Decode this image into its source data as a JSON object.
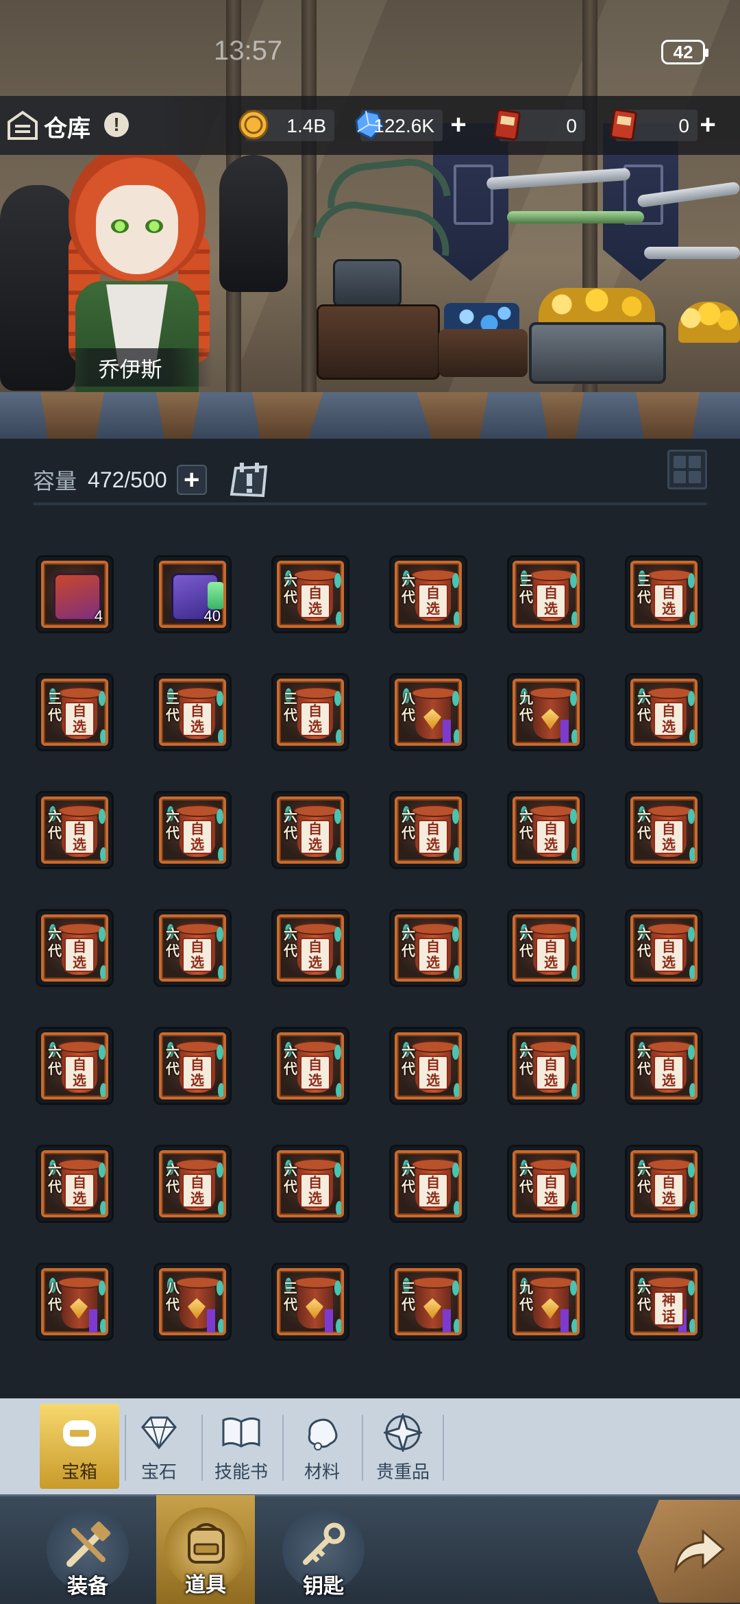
{
  "status_bar": {
    "time": "13:57",
    "battery": "42"
  },
  "header": {
    "title": "仓库",
    "info_icon": "!",
    "resources": [
      {
        "name": "gold",
        "icon": "gold-coin-icon",
        "value": "1.4B"
      },
      {
        "name": "diamond",
        "icon": "diamond-icon",
        "value": "122.6K"
      },
      {
        "name": "generation-ticket",
        "icon": "ticket-red-icon",
        "value": "0"
      },
      {
        "name": "point-ticket",
        "icon": "ticket-point-icon",
        "value": "0"
      }
    ]
  },
  "hero": {
    "name": "乔伊斯"
  },
  "capacity": {
    "label": "容量",
    "value": "472/500"
  },
  "items": [
    {
      "kind": "chest-red",
      "count": "4"
    },
    {
      "kind": "chest-purple",
      "count": "40"
    },
    {
      "kind": "jar",
      "gen": "六代",
      "tag": "自选"
    },
    {
      "kind": "jar",
      "gen": "六代",
      "tag": "自选"
    },
    {
      "kind": "jar",
      "gen": "三代",
      "tag": "自选"
    },
    {
      "kind": "jar",
      "gen": "三代",
      "tag": "自选"
    },
    {
      "kind": "jar",
      "gen": "三代",
      "tag": "自选"
    },
    {
      "kind": "jar",
      "gen": "三代",
      "tag": "自选"
    },
    {
      "kind": "jar",
      "gen": "三代",
      "tag": "自选"
    },
    {
      "kind": "vase",
      "gen": "八代"
    },
    {
      "kind": "vase",
      "gen": "九代"
    },
    {
      "kind": "jar",
      "gen": "六代",
      "tag": "自选"
    },
    {
      "kind": "jar",
      "gen": "六代",
      "tag": "自选"
    },
    {
      "kind": "jar",
      "gen": "六代",
      "tag": "自选"
    },
    {
      "kind": "jar",
      "gen": "六代",
      "tag": "自选"
    },
    {
      "kind": "jar",
      "gen": "六代",
      "tag": "自选"
    },
    {
      "kind": "jar",
      "gen": "六代",
      "tag": "自选"
    },
    {
      "kind": "jar",
      "gen": "六代",
      "tag": "自选"
    },
    {
      "kind": "jar",
      "gen": "六代",
      "tag": "自选"
    },
    {
      "kind": "jar",
      "gen": "六代",
      "tag": "自选"
    },
    {
      "kind": "jar",
      "gen": "六代",
      "tag": "自选"
    },
    {
      "kind": "jar",
      "gen": "六代",
      "tag": "自选"
    },
    {
      "kind": "jar",
      "gen": "六代",
      "tag": "自选"
    },
    {
      "kind": "jar",
      "gen": "六代",
      "tag": "自选"
    },
    {
      "kind": "jar",
      "gen": "六代",
      "tag": "自选"
    },
    {
      "kind": "jar",
      "gen": "六代",
      "tag": "自选"
    },
    {
      "kind": "jar",
      "gen": "六代",
      "tag": "自选"
    },
    {
      "kind": "jar",
      "gen": "六代",
      "tag": "自选"
    },
    {
      "kind": "jar",
      "gen": "六代",
      "tag": "自选"
    },
    {
      "kind": "jar",
      "gen": "六代",
      "tag": "自选"
    },
    {
      "kind": "jar",
      "gen": "六代",
      "tag": "自选"
    },
    {
      "kind": "jar",
      "gen": "六代",
      "tag": "自选"
    },
    {
      "kind": "jar",
      "gen": "六代",
      "tag": "自选"
    },
    {
      "kind": "jar",
      "gen": "六代",
      "tag": "自选"
    },
    {
      "kind": "jar",
      "gen": "六代",
      "tag": "自选"
    },
    {
      "kind": "jar",
      "gen": "六代",
      "tag": "自选"
    },
    {
      "kind": "vase",
      "gen": "八代"
    },
    {
      "kind": "vase",
      "gen": "八代"
    },
    {
      "kind": "vase",
      "gen": "三代"
    },
    {
      "kind": "vase",
      "gen": "三代"
    },
    {
      "kind": "vase",
      "gen": "九代"
    },
    {
      "kind": "vase",
      "gen": "六代",
      "tag": "神话"
    }
  ],
  "category_tabs": [
    {
      "label": "宝箱",
      "icon": "chest-icon",
      "active": true
    },
    {
      "label": "宝石",
      "icon": "gem-icon",
      "active": false
    },
    {
      "label": "技能书",
      "icon": "book-icon",
      "active": false
    },
    {
      "label": "材料",
      "icon": "ore-icon",
      "active": false
    },
    {
      "label": "贵重品",
      "icon": "compass-star-icon",
      "active": false
    }
  ],
  "bottom_nav": [
    {
      "label": "装备",
      "icon": "sword-hammer-icon",
      "active": false
    },
    {
      "label": "道具",
      "icon": "backpack-icon",
      "active": true
    },
    {
      "label": "钥匙",
      "icon": "key-icon",
      "active": false
    }
  ],
  "colors": {
    "active_tab": "#d8b245",
    "panel_bg": "#1c232b",
    "slot_border": "#c96a2d"
  }
}
